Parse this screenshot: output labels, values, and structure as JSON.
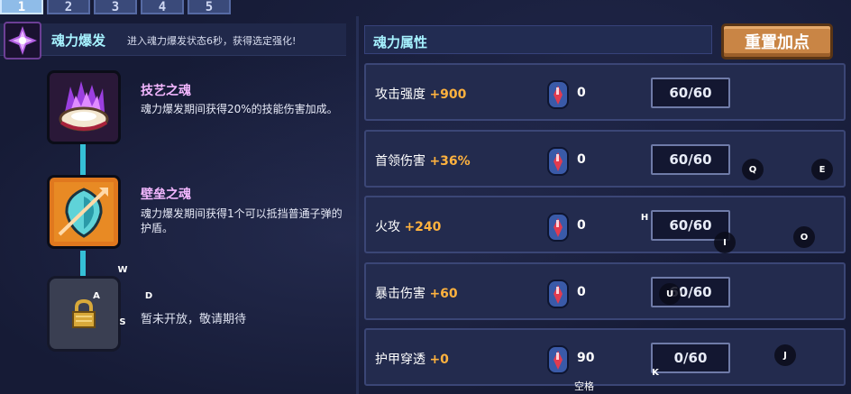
{
  "tabs": [
    "1",
    "2",
    "3",
    "4",
    "5"
  ],
  "active_tab": "1",
  "soul_burst": {
    "title": "魂力爆发",
    "description": "进入魂力爆发状态6秒，获得选定强化!"
  },
  "skills": [
    {
      "title": "技艺之魂",
      "description": "魂力爆发期间获得20%的技能伤害加成。",
      "icon": "purple-flame-shell-icon"
    },
    {
      "title": "壁垒之魂",
      "description": "魂力爆发期间获得1个可以抵挡普通子弹的护盾。",
      "icon": "cyan-shield-icon"
    }
  ],
  "locked": {
    "text": "暂未开放，敬请期待",
    "icon": "padlock-icon"
  },
  "attributes_panel": {
    "title": "魂力属性",
    "reset_label": "重置加点"
  },
  "attributes": [
    {
      "name": "攻击强度",
      "bonus": "+900",
      "cost": "0",
      "level": "60/60"
    },
    {
      "name": "首领伤害",
      "bonus": "+36%",
      "cost": "0",
      "level": "60/60"
    },
    {
      "name": "火攻",
      "bonus": "+240",
      "cost": "0",
      "level": "60/60"
    },
    {
      "name": "暴击伤害",
      "bonus": "+60",
      "cost": "0",
      "level": "60/60"
    },
    {
      "name": "护甲穿透",
      "bonus": "+0",
      "cost": "90",
      "level": "0/60"
    }
  ],
  "key_hints": {
    "w": "W",
    "a": "A",
    "s": "S",
    "d": "D",
    "q": "Q",
    "e": "E",
    "h": "H",
    "i": "I",
    "o": "O",
    "u": "U",
    "j": "J",
    "k": "K",
    "space": "空格"
  },
  "colors": {
    "background": "#161b36",
    "accent_cyan": "#a6f2ff",
    "bonus_orange": "#ffb23e",
    "button_orange": "#c98545",
    "skill_title": "#f3b7ff"
  }
}
